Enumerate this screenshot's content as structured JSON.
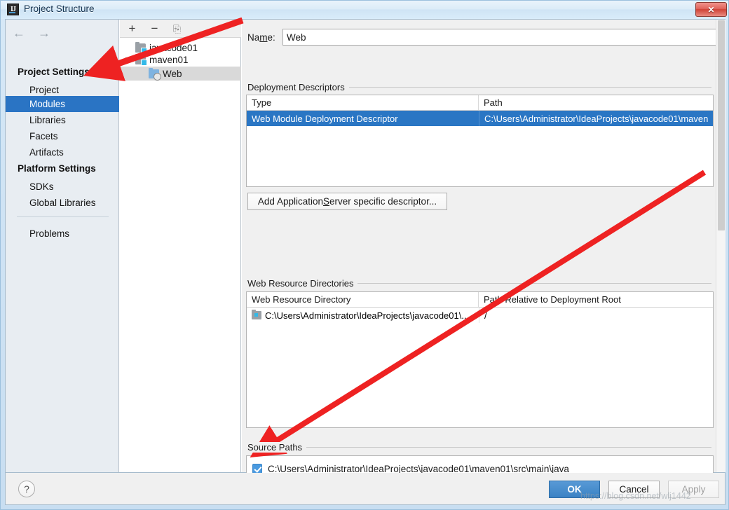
{
  "window": {
    "title": "Project Structure",
    "app_icon": "intellij-idea-icon",
    "close_label": "✕"
  },
  "sidebar": {
    "back_icon": "←",
    "forward_icon": "→",
    "sections": [
      {
        "header": "Project Settings",
        "items": [
          "Project",
          "Modules",
          "Libraries",
          "Facets",
          "Artifacts"
        ]
      },
      {
        "header": "Platform Settings",
        "items": [
          "SDKs",
          "Global Libraries"
        ]
      }
    ],
    "extra_items": [
      "Problems"
    ],
    "selected": "Modules"
  },
  "tree": {
    "toolbar": {
      "add": "+",
      "remove": "−",
      "copy": "⎘"
    },
    "nodes": [
      {
        "label": "javacode01",
        "icon": "module-icon",
        "depth": 0,
        "expanded": false
      },
      {
        "label": "maven01",
        "icon": "module-icon",
        "depth": 0,
        "expanded": true
      },
      {
        "label": "Web",
        "icon": "web-facet-icon",
        "depth": 1,
        "selected": true
      }
    ]
  },
  "main": {
    "name_label": "Name:",
    "name_value": "Web",
    "deployment_descriptors": {
      "title": "Deployment Descriptors",
      "columns": [
        "Type",
        "Path"
      ],
      "rows": [
        {
          "type": "Web Module Deployment Descriptor",
          "path": "C:\\Users\\Administrator\\IdeaProjects\\javacode01\\maven",
          "selected": true
        }
      ],
      "buttons": [
        "add-icon",
        "remove-icon",
        "edit-icon"
      ]
    },
    "add_descriptor_button": "Add Application Server specific descriptor...",
    "web_resource_directories": {
      "title": "Web Resource Directories",
      "columns": [
        "Web Resource Directory",
        "Path Relative to Deployment Root"
      ],
      "rows": [
        {
          "directory": "C:\\Users\\Administrator\\IdeaProjects\\javacode01\\...",
          "relative_path": "/"
        }
      ],
      "buttons": [
        "add-icon",
        "remove-icon",
        "edit-icon",
        "help-icon"
      ]
    },
    "source_paths": {
      "title": "Source Paths",
      "rows": [
        {
          "checked": true,
          "path": "C:\\Users\\Administrator\\IdeaProjects\\javacode01\\maven01\\src\\main\\java"
        }
      ]
    }
  },
  "footer": {
    "help": "?",
    "ok": "OK",
    "cancel": "Cancel",
    "apply": "Apply"
  },
  "watermark": "https://blog.csdn.net/wlj1442",
  "colors": {
    "selection_blue": "#2a76c4",
    "sidebar_selection": "#2a74c4",
    "tree_selection": "#d9d9d9",
    "accent_checkbox": "#4a9ae0",
    "annotation_red": "#ee2222"
  }
}
